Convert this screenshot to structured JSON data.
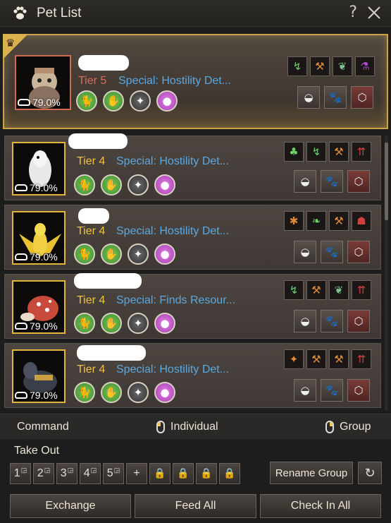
{
  "window": {
    "title": "Pet List",
    "help_label": "?"
  },
  "pets": [
    {
      "tier": "Tier 5",
      "special": "Special: Hostility Det...",
      "food": "79.0%"
    },
    {
      "tier": "Tier 4",
      "special": "Special: Hostility Det...",
      "food": "79.0%"
    },
    {
      "tier": "Tier 4",
      "special": "Special: Hostility Det...",
      "food": "79.0%"
    },
    {
      "tier": "Tier 4",
      "special": "Special: Finds Resour...",
      "food": "79.0%"
    },
    {
      "tier": "Tier 4",
      "special": "Special: Hostility Det...",
      "food": "79.0%"
    }
  ],
  "command": {
    "label": "Command",
    "individual": "Individual",
    "group": "Group"
  },
  "take_out": {
    "label": "Take Out",
    "slots": [
      "1",
      "2",
      "3",
      "4",
      "5"
    ],
    "add_symbol": "+",
    "rename_group": "Rename Group"
  },
  "buttons": {
    "exchange": "Exchange",
    "feed_all": "Feed All",
    "check_in_all": "Check In All"
  },
  "colors": {
    "tier5": "#d86b5a",
    "tier4": "#f2c046",
    "special": "#5ba8e0",
    "top_border": "#c9a24a"
  }
}
